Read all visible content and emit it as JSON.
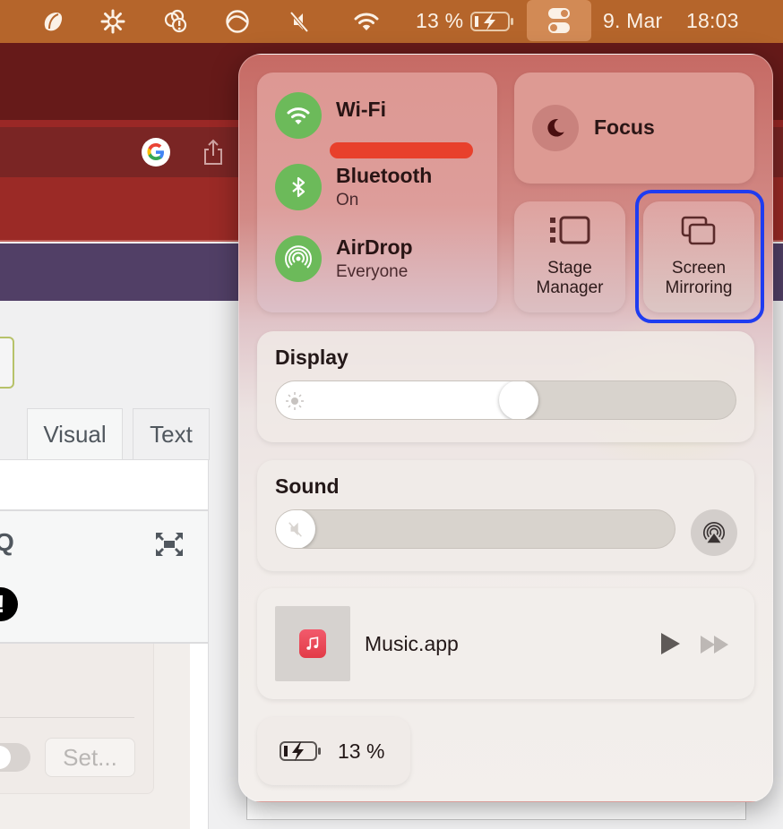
{
  "menubar": {
    "icons": [
      "app-leaf-icon",
      "sun-burst-icon",
      "cloud-alert-icon",
      "circle-wave-icon",
      "speaker-muted-icon",
      "wifi-icon"
    ],
    "battery_percent": "13 %",
    "battery_icon": "battery-charging-icon",
    "control_center_icon": "control-center-toggles-icon",
    "date": "9. Mar",
    "time": "18:03",
    "colors": {
      "bar": "#b5652b",
      "active": "#d28a55"
    }
  },
  "background": {
    "browser_icons": [
      "google-icon",
      "share-icon"
    ],
    "tabs": [
      {
        "label": "Visual",
        "active": true
      },
      {
        "label": "Text",
        "active": false
      }
    ],
    "set_button": "Set..."
  },
  "control_center": {
    "network": {
      "wifi": {
        "label": "Wi-Fi",
        "status": "[redacted]"
      },
      "bluetooth": {
        "label": "Bluetooth",
        "status": "On"
      },
      "airdrop": {
        "label": "AirDrop",
        "status": "Everyone"
      },
      "accent": "#6cba5a"
    },
    "focus": {
      "label": "Focus"
    },
    "stage_manager": {
      "line1": "Stage",
      "line2": "Manager"
    },
    "screen_mirroring": {
      "line1": "Screen",
      "line2": "Mirroring",
      "highlighted": true,
      "highlight_color": "#1f3cf0"
    },
    "display": {
      "label": "Display",
      "brightness": 0.53
    },
    "sound": {
      "label": "Sound",
      "volume": 0.0,
      "muted": true
    },
    "now_playing": {
      "app": "Music.app"
    },
    "battery": {
      "percent": "13 %",
      "charging": true
    }
  }
}
